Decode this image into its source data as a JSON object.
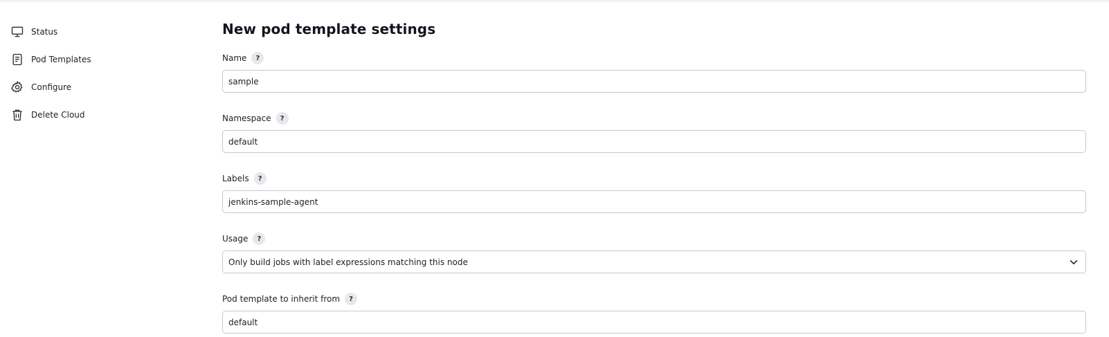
{
  "sidebar": {
    "items": [
      {
        "label": "Status",
        "icon": "monitor-icon"
      },
      {
        "label": "Pod Templates",
        "icon": "document-icon"
      },
      {
        "label": "Configure",
        "icon": "gear-icon"
      },
      {
        "label": "Delete Cloud",
        "icon": "trash-icon"
      }
    ]
  },
  "main": {
    "title": "New pod template settings",
    "help_glyph": "?",
    "fields": {
      "name": {
        "label": "Name",
        "value": "sample"
      },
      "namespace": {
        "label": "Namespace",
        "value": "default"
      },
      "labels": {
        "label": "Labels",
        "value": "jenkins-sample-agent"
      },
      "usage": {
        "label": "Usage",
        "value": "Only build jobs with label expressions matching this node"
      },
      "inherit": {
        "label": "Pod template to inherit from",
        "value": "default"
      }
    }
  },
  "colors": {
    "text": "#1e1e28",
    "border": "#c8c8cf",
    "help_bg": "#e8e8ec"
  }
}
